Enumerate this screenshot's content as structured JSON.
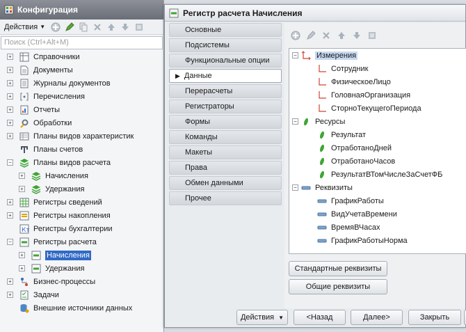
{
  "config_window": {
    "title": "Конфигурация",
    "actions_label": "Действия",
    "search_placeholder": "Поиск (Ctrl+Alt+M)",
    "tree": [
      {
        "label": "Справочники",
        "icon": "catalog-icon",
        "expander": "plus",
        "level": 0
      },
      {
        "label": "Документы",
        "icon": "document-icon",
        "expander": "plus",
        "level": 0
      },
      {
        "label": "Журналы документов",
        "icon": "journal-icon",
        "expander": "plus",
        "level": 0
      },
      {
        "label": "Перечисления",
        "icon": "enum-icon",
        "expander": "plus",
        "level": 0
      },
      {
        "label": "Отчеты",
        "icon": "report-icon",
        "expander": "plus",
        "level": 0
      },
      {
        "label": "Обработки",
        "icon": "processing-icon",
        "expander": "plus",
        "level": 0
      },
      {
        "label": "Планы видов характеристик",
        "icon": "chart-characteristics-icon",
        "expander": "plus",
        "level": 0
      },
      {
        "label": "Планы счетов",
        "icon": "chart-accounts-icon",
        "expander": "none",
        "level": 0
      },
      {
        "label": "Планы видов расчета",
        "icon": "calculation-types-icon",
        "expander": "minus",
        "level": 0
      },
      {
        "label": "Начисления",
        "icon": "calculation-types-icon",
        "expander": "plus",
        "level": 1
      },
      {
        "label": "Удержания",
        "icon": "calculation-types-icon",
        "expander": "plus",
        "level": 1
      },
      {
        "label": "Регистры сведений",
        "icon": "info-register-icon",
        "expander": "plus",
        "level": 0
      },
      {
        "label": "Регистры накопления",
        "icon": "accumulation-register-icon",
        "expander": "plus",
        "level": 0
      },
      {
        "label": "Регистры бухгалтерии",
        "icon": "accounting-register-icon",
        "expander": "none",
        "level": 0
      },
      {
        "label": "Регистры расчета",
        "icon": "calculation-register-icon",
        "expander": "minus",
        "level": 0
      },
      {
        "label": "Начисления",
        "icon": "calculation-register-icon",
        "expander": "plus",
        "level": 1,
        "selected": true
      },
      {
        "label": "Удержания",
        "icon": "calculation-register-icon",
        "expander": "plus",
        "level": 1
      },
      {
        "label": "Бизнес-процессы",
        "icon": "business-process-icon",
        "expander": "plus",
        "level": 0
      },
      {
        "label": "Задачи",
        "icon": "task-icon",
        "expander": "plus",
        "level": 0
      },
      {
        "label": "Внешние источники данных",
        "icon": "external-data-icon",
        "expander": "none",
        "level": 0
      }
    ]
  },
  "register_window": {
    "title": "Регистр расчета Начисления",
    "tabs": [
      "Основные",
      "Подсистемы",
      "Функциональные опции",
      "Данные",
      "Перерасчеты",
      "Регистраторы",
      "Формы",
      "Команды",
      "Макеты",
      "Права",
      "Обмен данными",
      "Прочее"
    ],
    "active_tab": "Данные",
    "metadata_tree": {
      "groups": [
        {
          "label": "Измерения",
          "icon": "dimension-icon",
          "highlighted": true,
          "items": [
            "Сотрудник",
            "ФизическоеЛицо",
            "ГоловнаяОрганизация",
            "СторноТекущегоПериода"
          ]
        },
        {
          "label": "Ресурсы",
          "icon": "resource-icon",
          "highlighted": false,
          "items": [
            "Результат",
            "ОтработаноДней",
            "ОтработаноЧасов",
            "РезультатВТомЧислеЗаСчетФБ"
          ]
        },
        {
          "label": "Реквизиты",
          "icon": "attribute-icon",
          "highlighted": false,
          "items": [
            "ГрафикРаботы",
            "ВидУчетаВремени",
            "ВремяВЧасах",
            "ГрафикРаботыНорма"
          ]
        }
      ]
    },
    "standard_attributes_label": "Стандартные реквизиты",
    "common_attributes_label": "Общие реквизиты",
    "footer": {
      "actions_label": "Действия",
      "back_label": "<Назад",
      "next_label": "Далее>",
      "close_label": "Закрыть"
    }
  },
  "colors": {
    "selection": "#316ac5",
    "highlight": "#c8d8f0",
    "green_icon": "#3fa535",
    "title_dark": "#6a6e77"
  }
}
